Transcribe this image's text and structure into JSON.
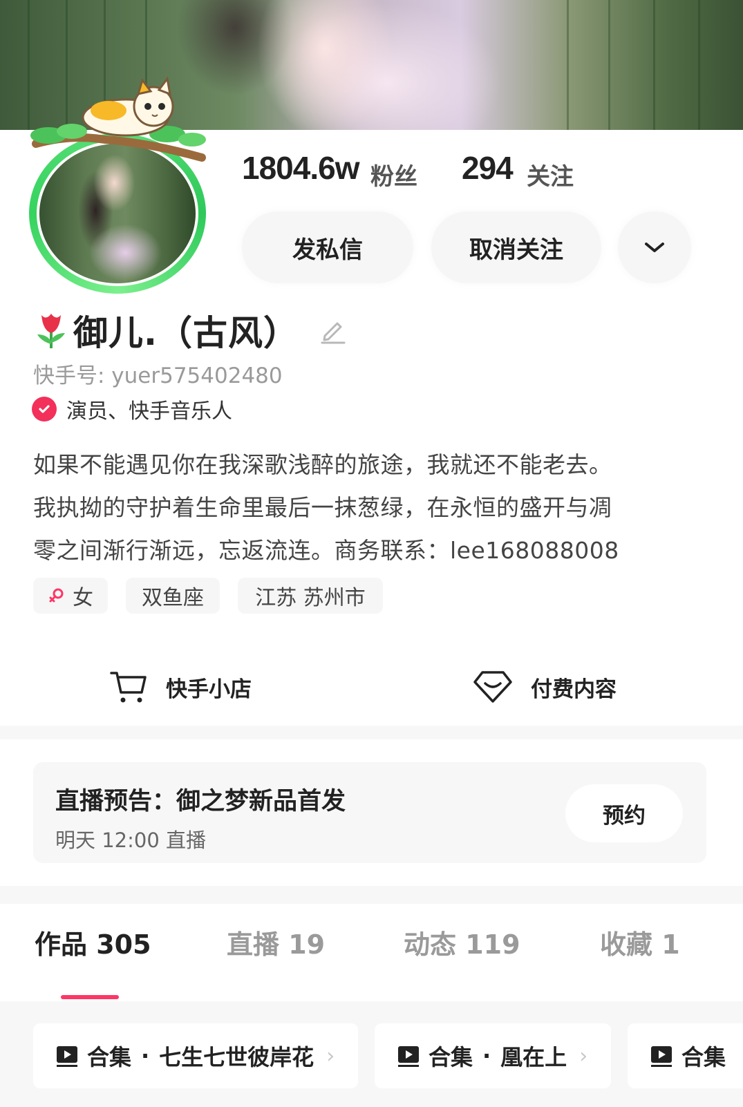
{
  "profile": {
    "followers_count": "1804.6w",
    "followers_label": "粉丝",
    "following_count": "294",
    "following_label": "关注",
    "name": "御儿.（古风）",
    "kuaishou_id": "快手号: yuer575402480",
    "verification": "演员、快手音乐人",
    "bio_lines": [
      "如果不能遇见你在我深歌浅醉的旅途，我就还不能老去。",
      "我执拗的守护着生命里最后一抹葱绿，在永恒的盛开与凋",
      "零之间渐行渐远，忘返流连。商务联系：lee168088008"
    ],
    "tags": {
      "gender": "女",
      "zodiac": "双鱼座",
      "location": "江苏 苏州市"
    }
  },
  "actions": {
    "message": "发私信",
    "unfollow": "取消关注"
  },
  "shop": {
    "store": "快手小店",
    "paid": "付费内容"
  },
  "live_notice": {
    "title": "直播预告：御之梦新品首发",
    "time": "明天 12:00 直播",
    "reserve": "预约"
  },
  "tabs": [
    {
      "label": "作品 305"
    },
    {
      "label": "直播 19"
    },
    {
      "label": "动态 119"
    },
    {
      "label": "收藏 1"
    }
  ],
  "collections": [
    {
      "type": "合集",
      "title": "七生七世彼岸花"
    },
    {
      "type": "合集",
      "title": "凰在上"
    },
    {
      "type": "合集"
    }
  ],
  "colors": {
    "accent": "#fe3666",
    "verify": "#f2305a",
    "avatar_ring": "#36d35f"
  },
  "icons": [
    "edit-icon",
    "verified-check-icon",
    "female-icon",
    "cart-icon",
    "diamond-icon",
    "chevron-down-icon",
    "play-icon",
    "chevron-right-icon",
    "tulip-icon"
  ]
}
